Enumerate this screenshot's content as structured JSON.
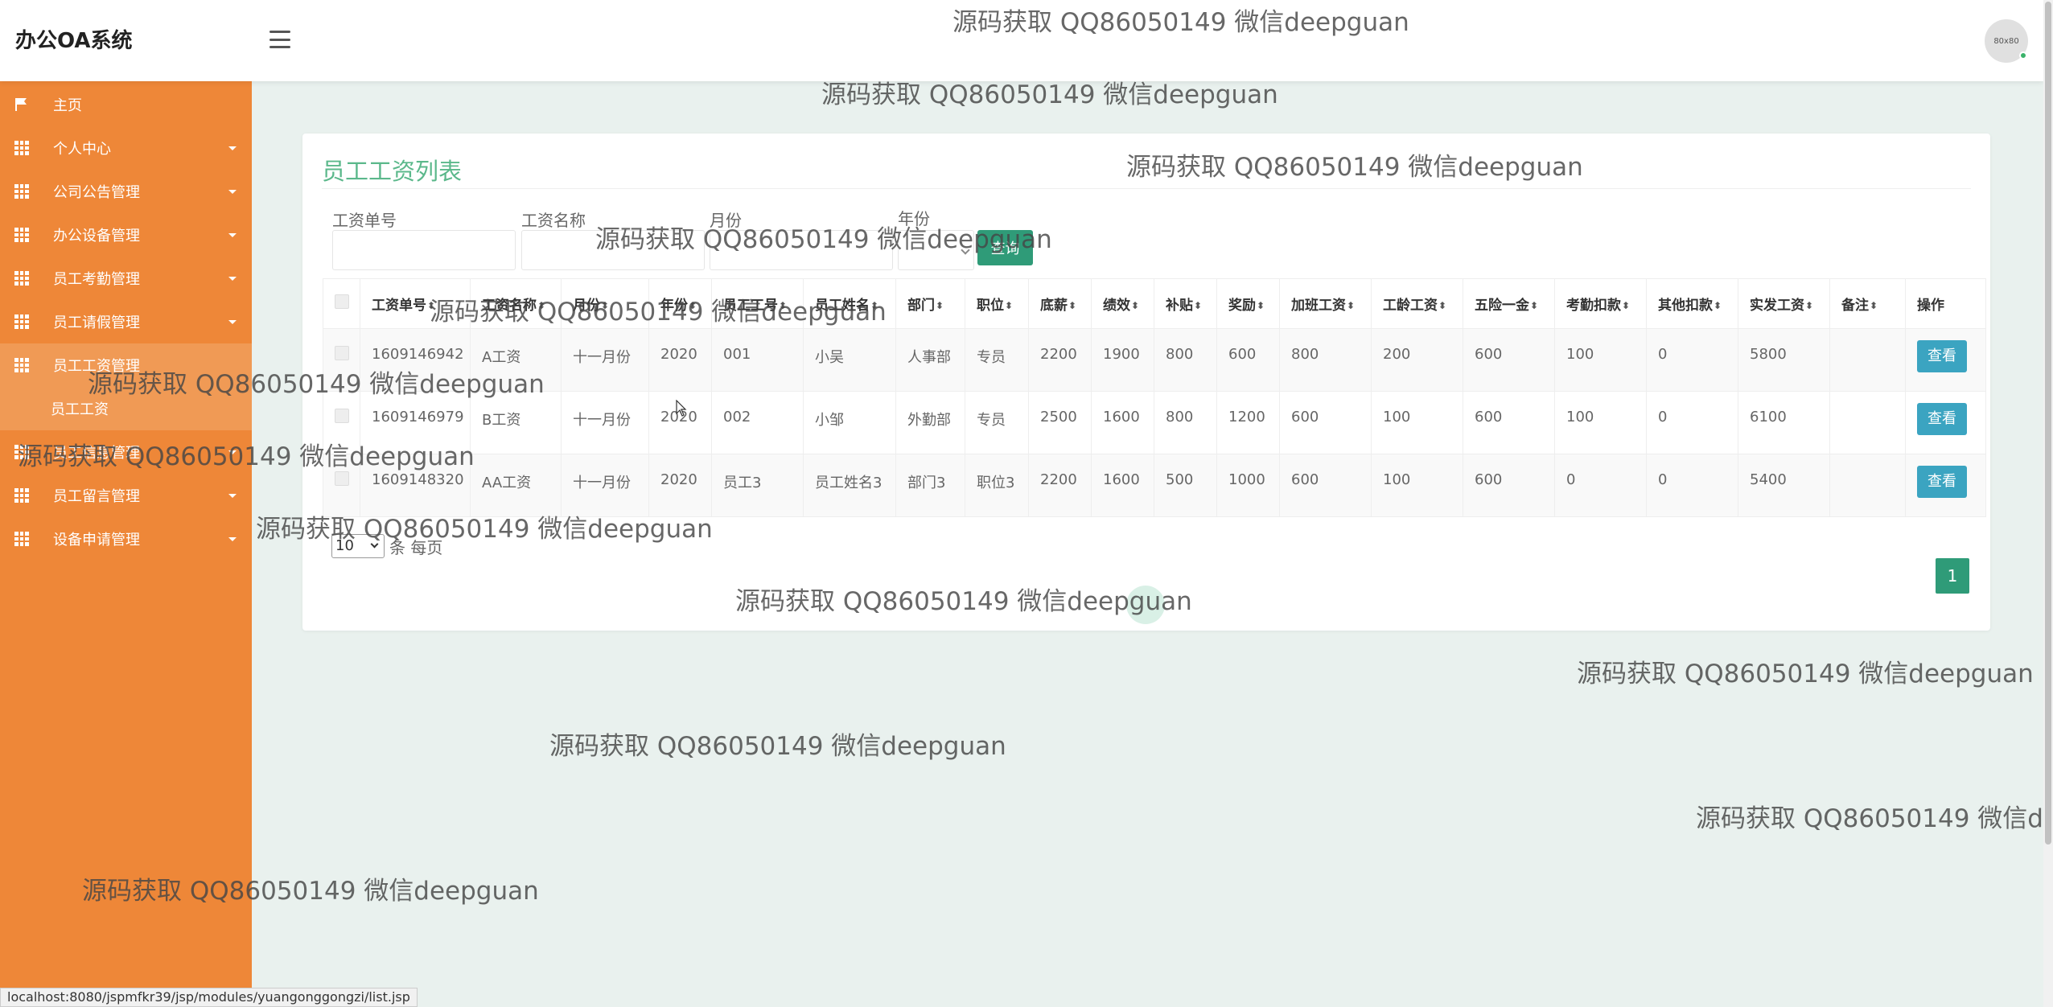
{
  "app": {
    "title": "办公OA系统",
    "avatar_text": "80x80"
  },
  "sidebar": {
    "items": [
      {
        "label": "主页",
        "icon": "flag-icon"
      },
      {
        "label": "个人中心",
        "icon": "grid-icon"
      },
      {
        "label": "公司公告管理",
        "icon": "grid-icon"
      },
      {
        "label": "办公设备管理",
        "icon": "grid-icon"
      },
      {
        "label": "员工考勤管理",
        "icon": "grid-icon"
      },
      {
        "label": "员工请假管理",
        "icon": "grid-icon"
      },
      {
        "label": "员工工资管理",
        "icon": "grid-icon"
      },
      {
        "label": "员工信息管理",
        "icon": "grid-icon"
      },
      {
        "label": "员工留言管理",
        "icon": "grid-icon"
      },
      {
        "label": "设备申请管理",
        "icon": "grid-icon"
      }
    ],
    "sub_item": "员工工资"
  },
  "page": {
    "title": "员工工资列表",
    "filters": {
      "salary_no_label": "工资单号",
      "salary_name_label": "工资名称",
      "month_label": "月份",
      "year_label": "年份",
      "query_button": "查询"
    }
  },
  "table": {
    "headers": [
      "工资单号",
      "工资名称",
      "月份",
      "年份",
      "员工工号",
      "员工姓名",
      "部门",
      "职位",
      "底薪",
      "绩效",
      "补贴",
      "奖励",
      "加班工资",
      "工龄工资",
      "五险一金",
      "考勤扣款",
      "其他扣款",
      "实发工资",
      "备注",
      "操作"
    ],
    "rows": [
      [
        "1609146942",
        "A工资",
        "十一月份",
        "2020",
        "001",
        "小吴",
        "人事部",
        "专员",
        "2200",
        "1900",
        "800",
        "600",
        "800",
        "200",
        "600",
        "100",
        "0",
        "5800",
        "",
        "查看"
      ],
      [
        "1609146979",
        "B工资",
        "十一月份",
        "2020",
        "002",
        "小邹",
        "外勤部",
        "专员",
        "2500",
        "1600",
        "800",
        "1200",
        "600",
        "100",
        "600",
        "100",
        "0",
        "6100",
        "",
        "查看"
      ],
      [
        "1609148320",
        "AA工资",
        "十一月份",
        "2020",
        "员工3",
        "员工姓名3",
        "部门3",
        "职位3",
        "2200",
        "1600",
        "500",
        "1000",
        "600",
        "100",
        "600",
        "0",
        "0",
        "5400",
        "",
        "查看"
      ]
    ]
  },
  "pagination": {
    "page_size": "10",
    "per_page_label": "条 每页",
    "current_page": "1"
  },
  "watermark": "源码获取 QQ86050149 微信deepguan",
  "statusbar": "localhost:8080/jspmfkr39/jsp/modules/yuangonggongzi/list.jsp",
  "colors": {
    "sidebar": "#ee8738",
    "accent": "#2f9b78",
    "title": "#5bb88b",
    "view_button": "#3ba4c1"
  }
}
